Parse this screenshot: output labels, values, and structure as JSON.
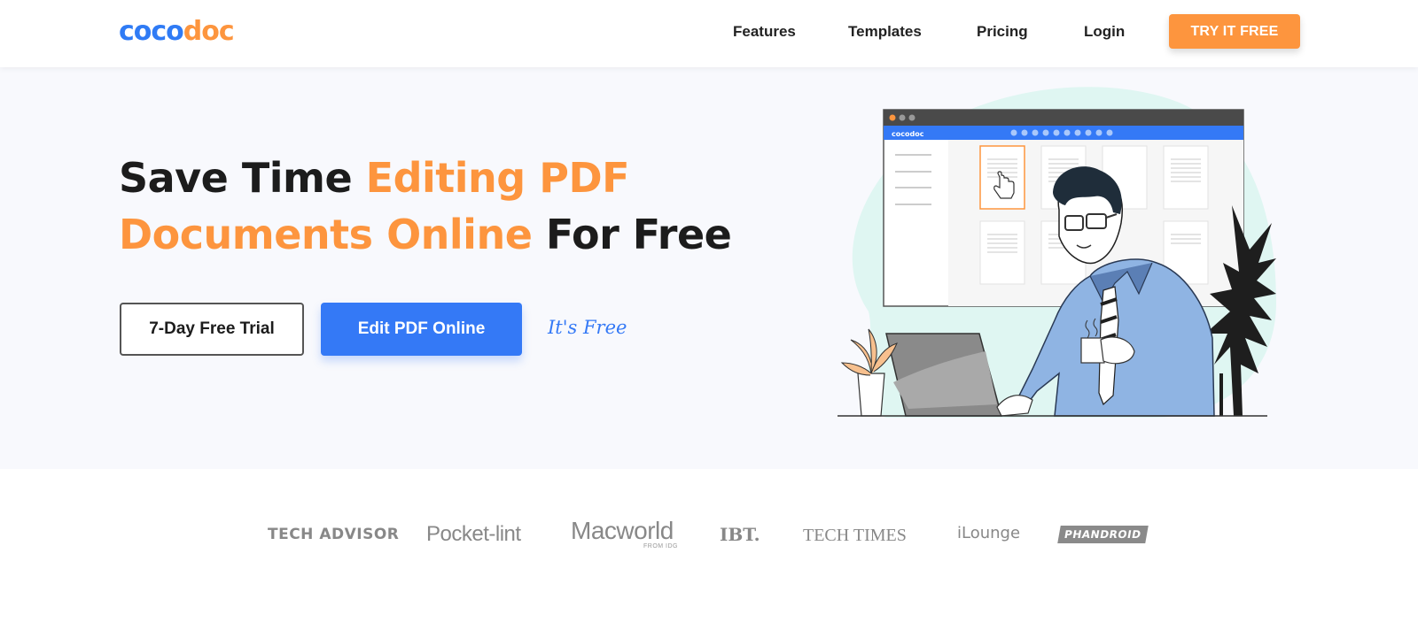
{
  "brand": {
    "logo_part1": "coco",
    "logo_part2": "doc",
    "primary_color": "#3479f6",
    "accent_color": "#fd953e"
  },
  "nav": {
    "links": [
      {
        "label": "Features"
      },
      {
        "label": "Templates"
      },
      {
        "label": "Pricing"
      },
      {
        "label": "Login"
      }
    ],
    "cta_label": "TRY IT FREE"
  },
  "hero": {
    "headline": {
      "part1": "Save Time ",
      "part2": "Editing PDF",
      "part3": "Documents Online",
      "part4": " For Free"
    },
    "trial_button": "7-Day Free Trial",
    "edit_button": "Edit PDF Online",
    "free_note": "It's Free",
    "illustration": {
      "app_logo": "cocodoc",
      "icon": "man-at-laptop-illustration"
    }
  },
  "press": {
    "logos": [
      {
        "name": "TECH ADVISOR"
      },
      {
        "name": "Pocket-lint"
      },
      {
        "name": "Macworld",
        "sub": "FROM IDG"
      },
      {
        "name": "IBT."
      },
      {
        "name": "TECH TIMES"
      },
      {
        "name": "iLounge"
      },
      {
        "name": "PHANDROID"
      }
    ]
  }
}
